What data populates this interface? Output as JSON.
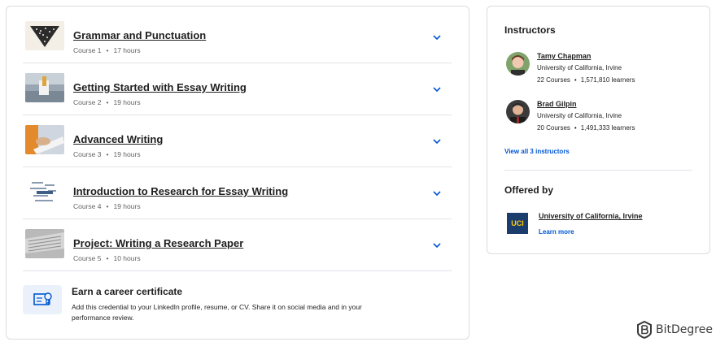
{
  "courses": [
    {
      "title": "Grammar and Punctuation",
      "number": "Course 1",
      "hours": "17 hours"
    },
    {
      "title": "Getting Started with Essay Writing",
      "number": "Course 2",
      "hours": "19 hours"
    },
    {
      "title": "Advanced Writing",
      "number": "Course 3",
      "hours": "19 hours"
    },
    {
      "title": "Introduction to Research for Essay Writing",
      "number": "Course 4",
      "hours": "19 hours"
    },
    {
      "title": "Project: Writing a Research Paper",
      "number": "Course 5",
      "hours": "10 hours"
    }
  ],
  "separator": "•",
  "certificate": {
    "title": "Earn a career certificate",
    "description": "Add this credential to your LinkedIn profile, resume, or CV. Share it on social media and in your performance review."
  },
  "instructors_section": {
    "heading": "Instructors",
    "instructors": [
      {
        "name": "Tamy Chapman",
        "org": "University of California, Irvine",
        "courses": "22 Courses",
        "learners": "1,571,810 learners"
      },
      {
        "name": "Brad Gilpin",
        "org": "University of California, Irvine",
        "courses": "20 Courses",
        "learners": "1,491,333 learners"
      }
    ],
    "view_all": "View all 3 instructors"
  },
  "offered_by": {
    "heading": "Offered by",
    "logo_text": "UCI",
    "org_name": "University of California, Irvine",
    "learn_more": "Learn more"
  },
  "watermark": {
    "text": "BitDegree"
  },
  "colors": {
    "link_blue": "#0056d2",
    "uci_blue": "#1b3d6d",
    "uci_gold": "#fecc07"
  }
}
